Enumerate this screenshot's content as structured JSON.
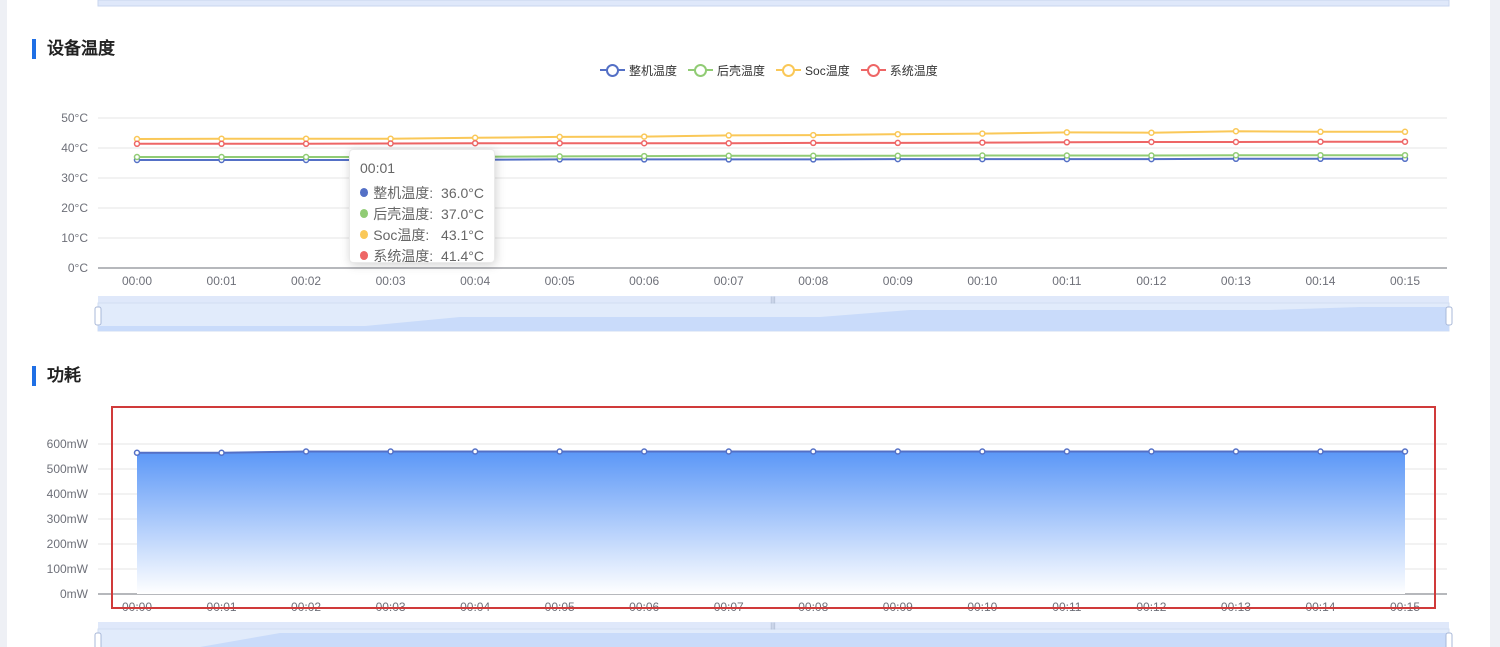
{
  "sections": {
    "temperature_title": "设备温度",
    "power_title": "功耗"
  },
  "colors": {
    "accent": "#1f6fe5",
    "grid": "#e6e6e6",
    "axis": "#6e7079",
    "slider_bg": "#e1ebfb",
    "slider_fill": "#c9dbfa",
    "highlight": "#d03a3a"
  },
  "tooltip": {
    "time": "00:01",
    "rows": [
      {
        "name": "整机温度:",
        "value": "36.0°C",
        "color": "#5470c6"
      },
      {
        "name": "后壳温度:",
        "value": "37.0°C",
        "color": "#91cc75"
      },
      {
        "name": "Soc温度:",
        "value": "43.1°C",
        "color": "#fac858"
      },
      {
        "name": "系统温度:",
        "value": "41.4°C",
        "color": "#ee6666"
      }
    ]
  },
  "chart_data": [
    {
      "type": "line",
      "title": "设备温度",
      "categories": [
        "00:00",
        "00:01",
        "00:02",
        "00:03",
        "00:04",
        "00:05",
        "00:06",
        "00:07",
        "00:08",
        "00:09",
        "00:10",
        "00:11",
        "00:12",
        "00:13",
        "00:14",
        "00:15"
      ],
      "y_ticks": [
        "0°C",
        "10°C",
        "20°C",
        "30°C",
        "40°C",
        "50°C"
      ],
      "ylim": [
        0,
        50
      ],
      "grid": true,
      "legend_position": "top-center",
      "series": [
        {
          "name": "整机温度",
          "color": "#5470c6",
          "values": [
            36.0,
            36.0,
            36.0,
            36.0,
            36.1,
            36.2,
            36.2,
            36.2,
            36.2,
            36.3,
            36.3,
            36.3,
            36.3,
            36.4,
            36.4,
            36.4
          ]
        },
        {
          "name": "后壳温度",
          "color": "#91cc75",
          "values": [
            37.0,
            37.0,
            37.0,
            37.0,
            37.1,
            37.2,
            37.3,
            37.4,
            37.4,
            37.4,
            37.5,
            37.5,
            37.5,
            37.6,
            37.6,
            37.6
          ]
        },
        {
          "name": "Soc温度",
          "color": "#fac858",
          "values": [
            43.0,
            43.1,
            43.1,
            43.1,
            43.4,
            43.7,
            43.8,
            44.2,
            44.3,
            44.6,
            44.8,
            45.2,
            45.1,
            45.6,
            45.4,
            45.4
          ]
        },
        {
          "name": "系统温度",
          "color": "#ee6666",
          "values": [
            41.4,
            41.4,
            41.4,
            41.5,
            41.6,
            41.6,
            41.6,
            41.6,
            41.7,
            41.7,
            41.8,
            41.9,
            42.0,
            42.0,
            42.1,
            42.1
          ]
        }
      ]
    },
    {
      "type": "area",
      "title": "功耗",
      "categories": [
        "00:00",
        "00:01",
        "00:02",
        "00:03",
        "00:04",
        "00:05",
        "00:06",
        "00:07",
        "00:08",
        "00:09",
        "00:10",
        "00:11",
        "00:12",
        "00:13",
        "00:14",
        "00:15"
      ],
      "y_ticks": [
        "0mW",
        "100mW",
        "200mW",
        "300mW",
        "400mW",
        "500mW",
        "600mW"
      ],
      "ylim": [
        0,
        600
      ],
      "grid": true,
      "series": [
        {
          "name": "功耗",
          "color": "#5470c6",
          "values": [
            565,
            565,
            570,
            570,
            570,
            570,
            570,
            570,
            570,
            570,
            570,
            570,
            570,
            570,
            570,
            570
          ]
        }
      ]
    }
  ]
}
